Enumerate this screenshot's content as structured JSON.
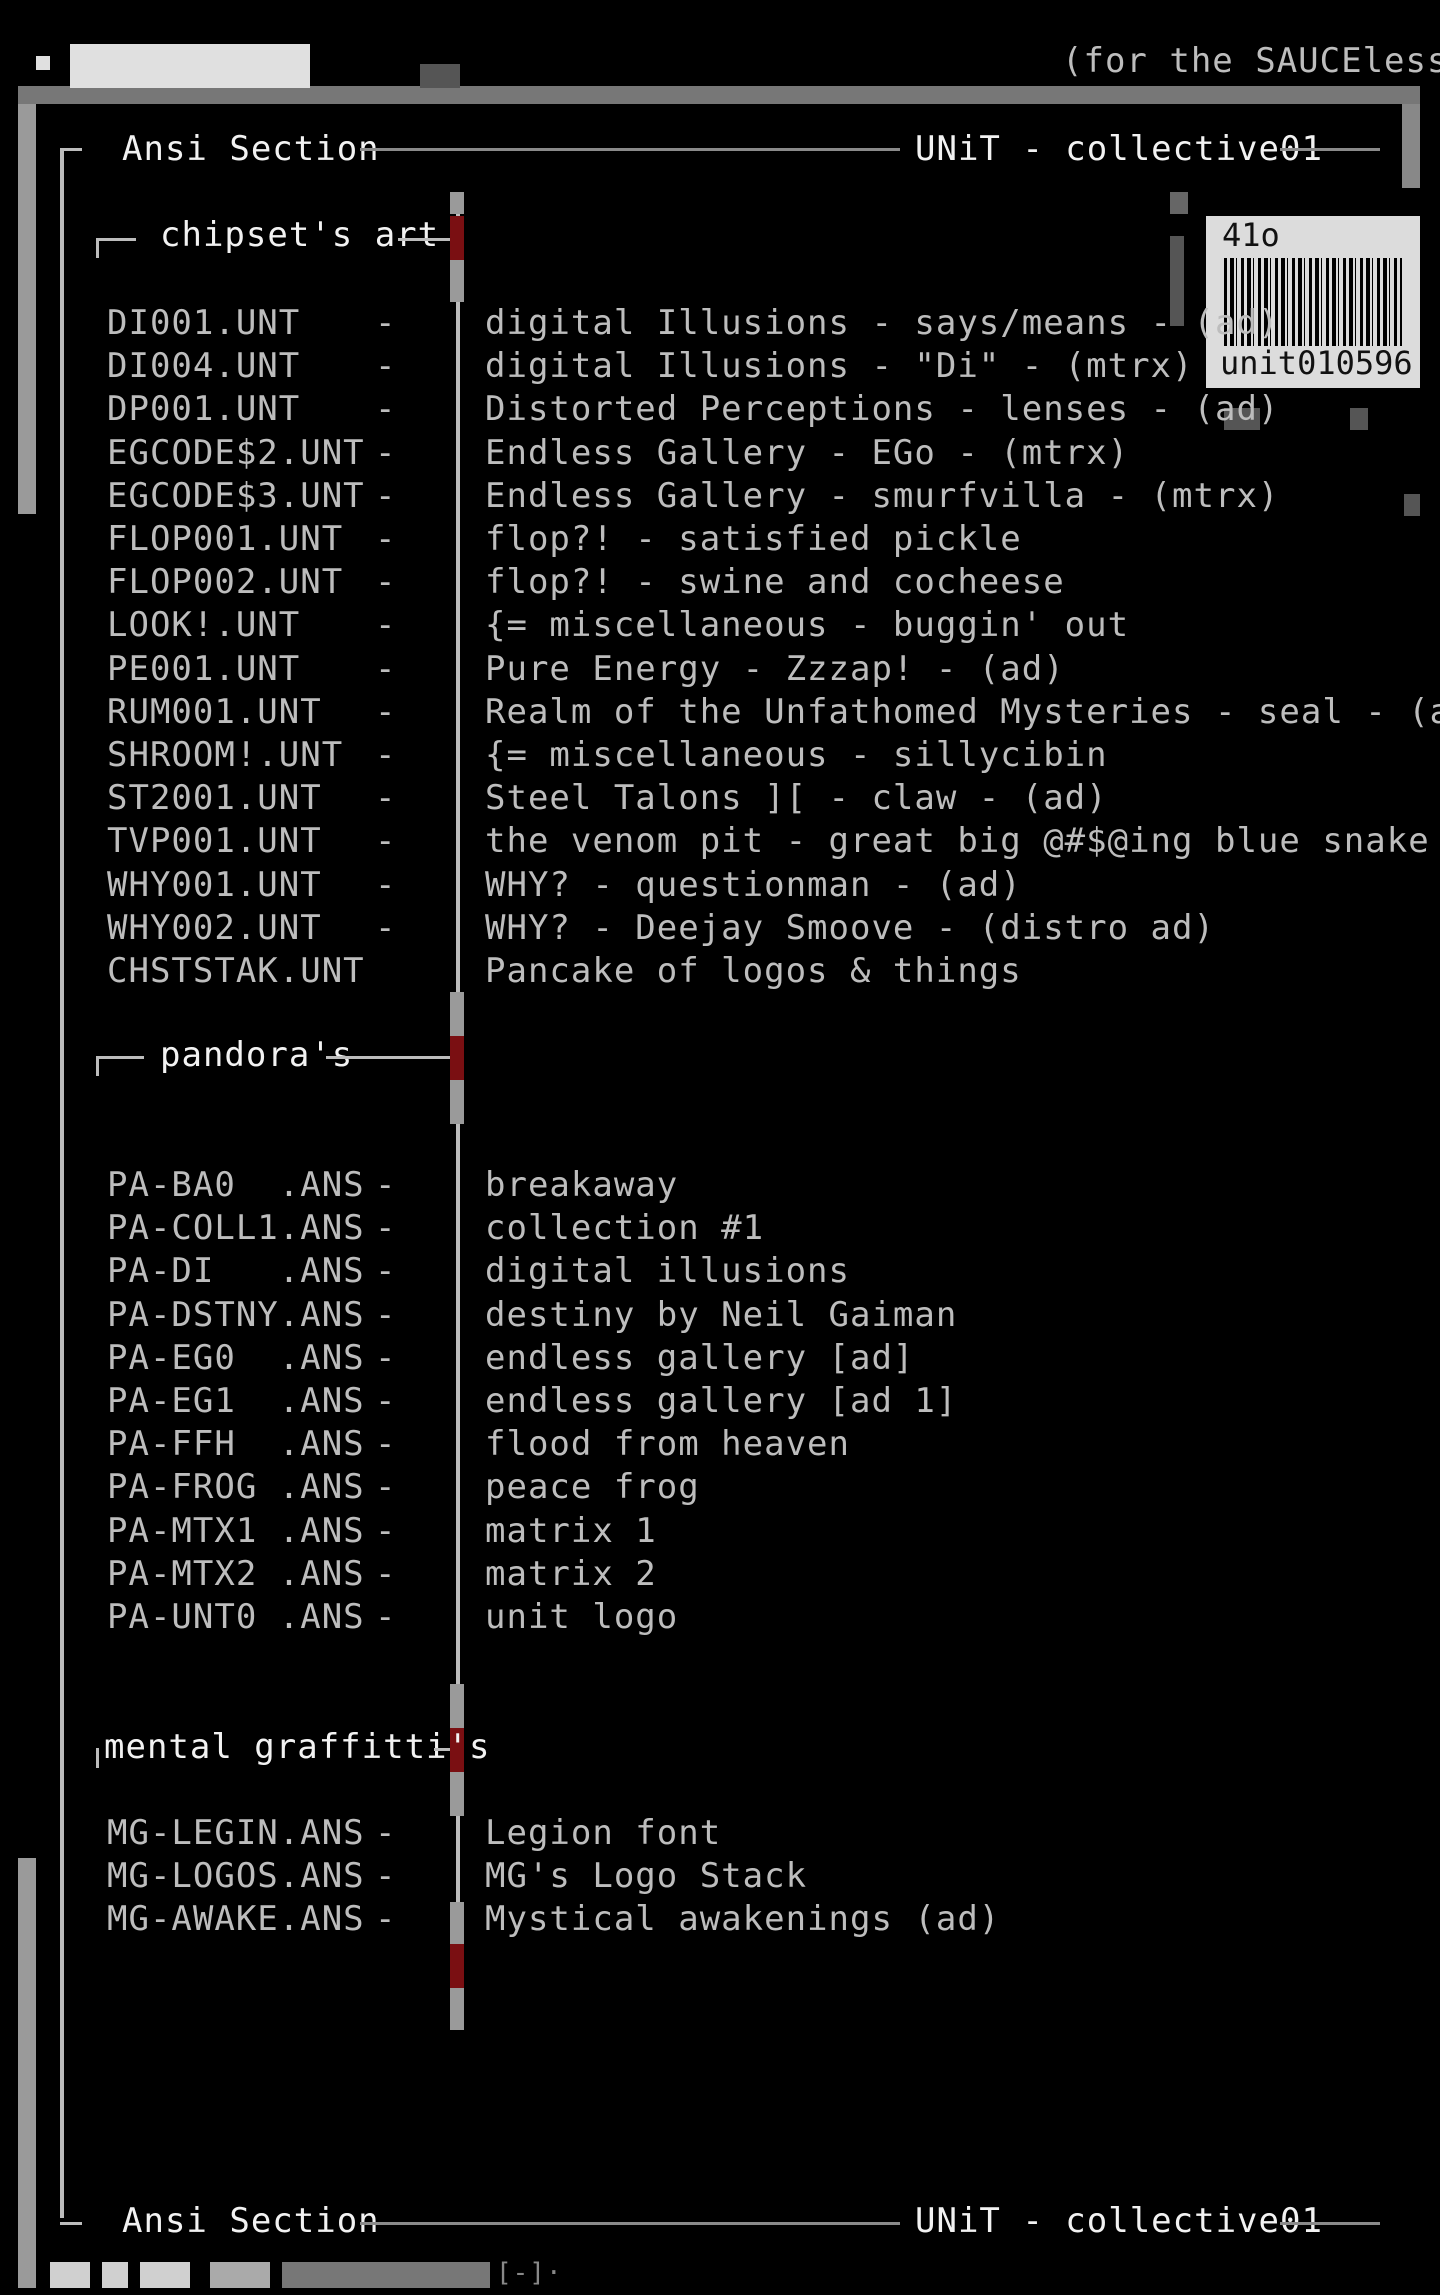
{
  "header": {
    "tagline": "(for the SAUCEless)",
    "section_title": "Ansi Section",
    "group_title": "UNiT - collective01"
  },
  "badge": {
    "number": "41o",
    "serial": "unit010596"
  },
  "footer": {
    "section_title": "Ansi Section",
    "group_title": "UNiT - collective01",
    "marker": "[-]·"
  },
  "sections": [
    {
      "title": "chipset's art",
      "rows": [
        {
          "file": "DI001.UNT",
          "dash": "-",
          "desc": "digital Illusions - says/means - (ad)"
        },
        {
          "file": "DI004.UNT",
          "dash": "-",
          "desc": "digital Illusions - \"Di\" - (mtrx)"
        },
        {
          "file": "DP001.UNT",
          "dash": "-",
          "desc": "Distorted Perceptions - lenses - (ad)"
        },
        {
          "file": "EGCODE$2.UNT",
          "dash": "-",
          "desc": "Endless Gallery - EGo - (mtrx)"
        },
        {
          "file": "EGCODE$3.UNT",
          "dash": "-",
          "desc": "Endless Gallery - smurfvilla - (mtrx)"
        },
        {
          "file": "FLOP001.UNT",
          "dash": "-",
          "desc": "flop?! - satisfied pickle"
        },
        {
          "file": "FLOP002.UNT",
          "dash": "-",
          "desc": "flop?! - swine and cocheese"
        },
        {
          "file": "LOOK!.UNT",
          "dash": "-",
          "desc": "{= miscellaneous - buggin' out"
        },
        {
          "file": "PE001.UNT",
          "dash": "-",
          "desc": "Pure Energy - Zzzap! - (ad)"
        },
        {
          "file": "RUM001.UNT",
          "dash": "-",
          "desc": "Realm of the Unfathomed Mysteries - seal - (ad)"
        },
        {
          "file": "SHROOM!.UNT",
          "dash": "-",
          "desc": "{= miscellaneous - sillycibin"
        },
        {
          "file": "ST2001.UNT",
          "dash": "-",
          "desc": "Steel Talons ][ - claw - (ad)"
        },
        {
          "file": "TVP001.UNT",
          "dash": "-",
          "desc": "the venom pit - great big @#$@ing blue snake"
        },
        {
          "file": "WHY001.UNT",
          "dash": "-",
          "desc": "WHY? - questionman - (ad)"
        },
        {
          "file": "WHY002.UNT",
          "dash": "-",
          "desc": "WHY? - Deejay Smoove - (distro ad)"
        },
        {
          "file": "CHSTSTAK.UNT",
          "dash": "",
          "desc": "Pancake of logos & things"
        }
      ]
    },
    {
      "title": "pandora's",
      "rows": [
        {
          "file": "PA-BA0  .ANS",
          "dash": "-",
          "desc": "breakaway"
        },
        {
          "file": "PA-COLL1.ANS",
          "dash": "-",
          "desc": "collection #1"
        },
        {
          "file": "PA-DI   .ANS",
          "dash": "-",
          "desc": "digital illusions"
        },
        {
          "file": "PA-DSTNY.ANS",
          "dash": "-",
          "desc": "destiny by Neil Gaiman"
        },
        {
          "file": "PA-EG0  .ANS",
          "dash": "-",
          "desc": "endless gallery [ad]"
        },
        {
          "file": "PA-EG1  .ANS",
          "dash": "-",
          "desc": "endless gallery [ad 1]"
        },
        {
          "file": "PA-FFH  .ANS",
          "dash": "-",
          "desc": "flood from heaven"
        },
        {
          "file": "PA-FROG .ANS",
          "dash": "-",
          "desc": "peace frog"
        },
        {
          "file": "PA-MTX1 .ANS",
          "dash": "-",
          "desc": "matrix 1"
        },
        {
          "file": "PA-MTX2 .ANS",
          "dash": "-",
          "desc": "matrix 2"
        },
        {
          "file": "PA-UNT0 .ANS",
          "dash": "-",
          "desc": "unit logo"
        }
      ]
    },
    {
      "title": "mental graffitti's",
      "rows": [
        {
          "file": "MG-LEGIN.ANS",
          "dash": "-",
          "desc": "Legion font"
        },
        {
          "file": "MG-LOGOS.ANS",
          "dash": "-",
          "desc": "MG's Logo Stack"
        },
        {
          "file": "MG-AWAKE.ANS",
          "dash": "-",
          "desc": "Mystical awakenings (ad)"
        }
      ]
    }
  ]
}
